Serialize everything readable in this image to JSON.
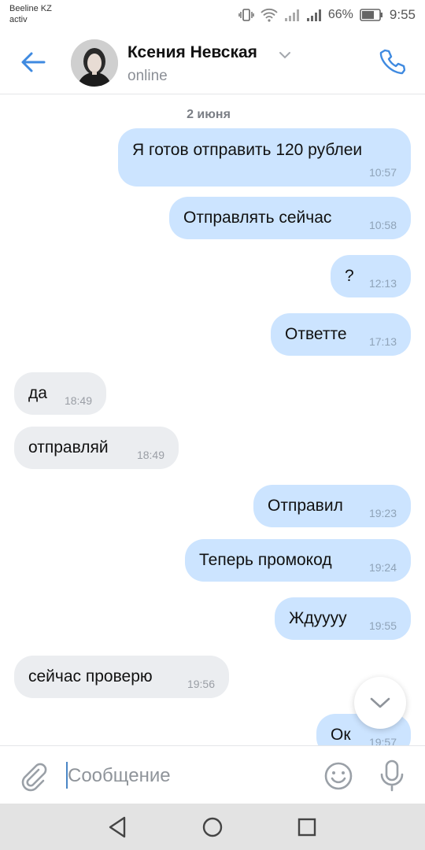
{
  "status_bar": {
    "carrier_line1": "Beeline KZ",
    "carrier_line2": "activ",
    "battery_percent": "66%",
    "time": "9:55",
    "icons": [
      "vibrate-icon",
      "wifi-icon",
      "signal-icon",
      "signal-icon",
      "battery-icon"
    ]
  },
  "header": {
    "contact_name": "Ксения Невская",
    "contact_status": "online",
    "icons": [
      "back-arrow-icon",
      "avatar",
      "chevron-down-icon",
      "phone-icon"
    ]
  },
  "chat": {
    "date_separator": "2 июня",
    "messages": [
      {
        "dir": "out",
        "text": "Я готов отправить 120 рублеи",
        "time": "10:57"
      },
      {
        "dir": "out",
        "text": "Отправлять сейчас",
        "time": "10:58"
      },
      {
        "dir": "out",
        "text": "?",
        "time": "12:13"
      },
      {
        "dir": "out",
        "text": "Ответте",
        "time": "17:13"
      },
      {
        "dir": "in",
        "text": "да",
        "time": "18:49"
      },
      {
        "dir": "in",
        "text": "отправляй",
        "time": "18:49"
      },
      {
        "dir": "out",
        "text": "Отправил",
        "time": "19:23"
      },
      {
        "dir": "out",
        "text": "Теперь промокод",
        "time": "19:24"
      },
      {
        "dir": "out",
        "text": "Ждуууу",
        "time": "19:55"
      },
      {
        "dir": "in",
        "text": "сейчас проверю",
        "time": "19:56"
      },
      {
        "dir": "out",
        "text": "Ок",
        "time": "19:57"
      }
    ]
  },
  "composer": {
    "placeholder": "Сообщение",
    "icons": [
      "paperclip-icon",
      "emoji-icon",
      "microphone-icon"
    ]
  },
  "colors": {
    "accent": "#3f8ae0",
    "outgoing_bubble": "#cce4ff",
    "incoming_bubble": "#ebedf0"
  }
}
